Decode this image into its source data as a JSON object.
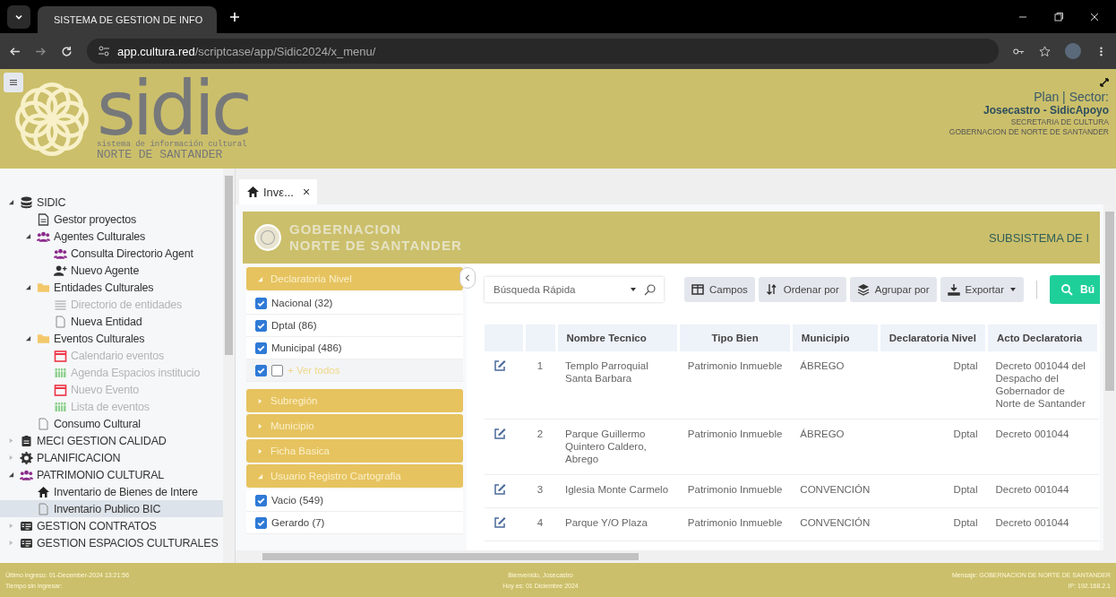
{
  "browser": {
    "tab_title": "SISTEMA DE GESTION DE INFO",
    "url_host": "app.cultura.red",
    "url_path": "/scriptcase/app/Sidic2024/x_menu/"
  },
  "header": {
    "logo_word": "sidic",
    "logo_tagline": "sistema de información cultural",
    "logo_region": "NORTE DE SANTANDER",
    "plan": "Plan | Sector:",
    "user": "Josecastro - SidicApoyo",
    "office": "SECRETARIA DE CULTURA",
    "entity": "GOBERNACION DE NORTE DE SANTANDER"
  },
  "sidebar": {
    "items": [
      {
        "label": "SIDIC",
        "expanded": true,
        "selected": false,
        "disabled": false,
        "children": [
          {
            "label": "Gestor proyectos",
            "selected": false,
            "disabled": false
          },
          {
            "label": "Agentes Culturales",
            "expanded": true,
            "selected": false,
            "disabled": false,
            "children": [
              {
                "label": "Consulta Directorio Agent",
                "selected": false,
                "disabled": false
              },
              {
                "label": "Nuevo Agente",
                "selected": false,
                "disabled": false
              }
            ]
          },
          {
            "label": "Entidades Culturales",
            "expanded": true,
            "selected": false,
            "disabled": false,
            "children": [
              {
                "label": "Directorio de entidades",
                "selected": false,
                "disabled": true
              },
              {
                "label": "Nueva Entidad",
                "selected": false,
                "disabled": false
              }
            ]
          },
          {
            "label": "Eventos Culturales",
            "expanded": true,
            "selected": false,
            "disabled": false,
            "children": [
              {
                "label": "Calendario eventos",
                "selected": false,
                "disabled": true
              },
              {
                "label": "Agenda Espacios institucio",
                "selected": false,
                "disabled": true
              },
              {
                "label": "Nuevo Evento",
                "selected": false,
                "disabled": true
              },
              {
                "label": "Lista de eventos",
                "selected": false,
                "disabled": true
              }
            ]
          },
          {
            "label": "Consumo Cultural",
            "selected": false,
            "disabled": false
          }
        ]
      },
      {
        "label": "MECI GESTION CALIDAD",
        "expanded": false,
        "selected": false,
        "disabled": false
      },
      {
        "label": "PLANIFICACION",
        "expanded": false,
        "selected": false,
        "disabled": false
      },
      {
        "label": "PATRIMONIO CULTURAL",
        "expanded": true,
        "selected": false,
        "disabled": false,
        "children": [
          {
            "label": "Inventario de Bienes de Intere",
            "selected": false,
            "disabled": false
          },
          {
            "label": "Inventario Publico BIC",
            "selected": true,
            "disabled": false
          }
        ]
      },
      {
        "label": "GESTION CONTRATOS",
        "expanded": false,
        "selected": false,
        "disabled": false
      },
      {
        "label": "GESTION ESPACIOS CULTURALES",
        "expanded": false,
        "selected": false,
        "disabled": false
      }
    ]
  },
  "content_tab": {
    "label": "Invε...",
    "close": "×"
  },
  "banner": {
    "line1": "GOBERNACION",
    "line2": "NORTE DE SANTANDER",
    "title": "SUBSISTEMA DE I"
  },
  "filters": [
    {
      "label": "Declaratoria Nivel",
      "expanded": true,
      "options": [
        {
          "label": "Nacional",
          "count": "(32)",
          "checked": true
        },
        {
          "label": "Dptal",
          "count": "(86)",
          "checked": true
        },
        {
          "label": "Municipal",
          "count": "(486)",
          "checked": true
        }
      ],
      "select_all": {
        "checked": true,
        "invert_checked": false,
        "label": "+ Ver todos"
      }
    },
    {
      "label": "Subregión",
      "expanded": false
    },
    {
      "label": "Municipio",
      "expanded": false
    },
    {
      "label": "Ficha Basica",
      "expanded": false
    },
    {
      "label": "Usuario Registro Cartografia",
      "expanded": true,
      "options": [
        {
          "label": "Vacio",
          "count": "(549)",
          "checked": true
        },
        {
          "label": "Gerardo",
          "count": "(7)",
          "checked": true
        }
      ]
    }
  ],
  "toolbar": {
    "search_placeholder": "Búsqueda Rápida",
    "buttons": [
      "Campos",
      "Ordenar por",
      "Agrupar por",
      "Exportar"
    ],
    "search_button": "Bú"
  },
  "table": {
    "columns": [
      "Nombre Tecnico",
      "Tipo Bien",
      "Municipio",
      "Declaratoria Nivel",
      "Acto Declaratoria"
    ],
    "rows": [
      {
        "number": "1",
        "cells": [
          "Templo Parroquial Santa Barbara",
          "Patrimonio Inmueble",
          "ÁBREGO",
          "Dptal",
          "Decreto 001044 del Despacho del Gobernador de Norte de Santander"
        ]
      },
      {
        "number": "2",
        "cells": [
          "Parque Guillermo Quintero Caldero, Abrego",
          "Patrimonio Inmueble",
          "ÁBREGO",
          "Dptal",
          "Decreto 001044"
        ]
      },
      {
        "number": "3",
        "cells": [
          "Iglesia Monte Carmelo",
          "Patrimonio Inmueble",
          "CONVENCIÓN",
          "Dptal",
          "Decreto 001044"
        ]
      },
      {
        "number": "4",
        "cells": [
          "Parque Y/O Plaza",
          "Patrimonio Inmueble",
          "CONVENCIÓN",
          "Dptal",
          "Decreto 001044"
        ]
      }
    ]
  },
  "status_bar": {
    "last_login": "Último ingreso: 01-December-2024 13:21:56",
    "idle": "Tiempo sin ingresar:",
    "welcome": "Bienvenido, Josecastro",
    "today": "Hoy es: 01 Diciembre 2024",
    "message": "Mensaje: GOBERNACION DE NORTE DE SANTANDER",
    "ip": "IP: 192.168.2.1"
  }
}
